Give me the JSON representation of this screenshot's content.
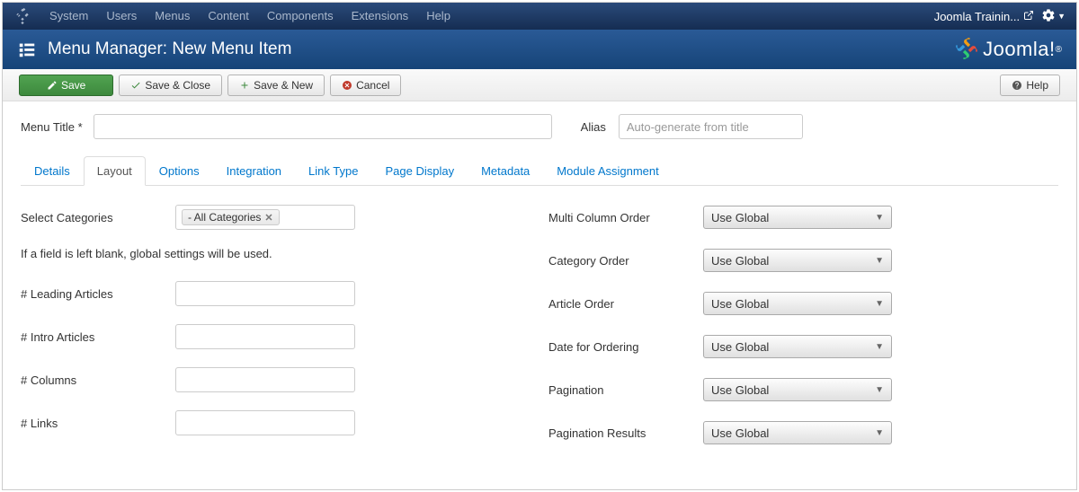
{
  "topbar": {
    "menus": [
      "System",
      "Users",
      "Menus",
      "Content",
      "Components",
      "Extensions",
      "Help"
    ],
    "site_label": "Joomla Trainin...",
    "brand": "Joomla!"
  },
  "titlebar": {
    "title": "Menu Manager: New Menu Item"
  },
  "toolbar": {
    "save": "Save",
    "save_close": "Save & Close",
    "save_new": "Save & New",
    "cancel": "Cancel",
    "help": "Help"
  },
  "title_row": {
    "menu_title_label": "Menu Title *",
    "menu_title_value": "",
    "alias_label": "Alias",
    "alias_placeholder": "Auto-generate from title"
  },
  "tabs": [
    "Details",
    "Layout",
    "Options",
    "Integration",
    "Link Type",
    "Page Display",
    "Metadata",
    "Module Assignment"
  ],
  "active_tab": "Layout",
  "left_fields": {
    "select_categories_label": "Select Categories",
    "select_categories_chip": "- All Categories",
    "note": "If a field is left blank, global settings will be used.",
    "leading_label": "# Leading Articles",
    "intro_label": "# Intro Articles",
    "columns_label": "# Columns",
    "links_label": "# Links"
  },
  "right_fields": {
    "multi_col_label": "Multi Column Order",
    "multi_col_value": "Use Global",
    "cat_order_label": "Category Order",
    "cat_order_value": "Use Global",
    "art_order_label": "Article Order",
    "art_order_value": "Use Global",
    "date_order_label": "Date for Ordering",
    "date_order_value": "Use Global",
    "pagination_label": "Pagination",
    "pagination_value": "Use Global",
    "pag_results_label": "Pagination Results",
    "pag_results_value": "Use Global"
  }
}
